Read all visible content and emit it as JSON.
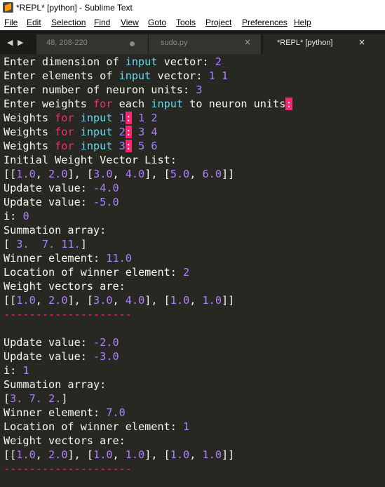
{
  "window": {
    "title": "*REPL* [python] - Sublime Text"
  },
  "menu": [
    "File",
    "Edit",
    "Selection",
    "Find",
    "View",
    "Goto",
    "Tools",
    "Project",
    "Preferences",
    "Help"
  ],
  "tabs": [
    {
      "label": "48, 208-220"
    },
    {
      "label": "sudo.py"
    },
    {
      "label": "*REPL* [python]"
    }
  ],
  "icons": {
    "nav_left": "◀",
    "nav_right": "▶",
    "close": "×"
  },
  "colors": {
    "background": "#272822",
    "keyword": "#f92672",
    "builtin": "#66d9ef",
    "number": "#ae81ff",
    "text": "#f8f8f2"
  },
  "console": [
    [
      [
        "t",
        "Enter dimension of "
      ],
      [
        "b",
        "input"
      ],
      [
        "t",
        " vector: "
      ],
      [
        "n",
        "2"
      ]
    ],
    [
      [
        "t",
        "Enter elements of "
      ],
      [
        "b",
        "input"
      ],
      [
        "t",
        " vector: "
      ],
      [
        "n",
        "1 1"
      ]
    ],
    [
      [
        "t",
        "Enter number of neuron units: "
      ],
      [
        "n",
        "3"
      ]
    ],
    [
      [
        "t",
        "Enter weights "
      ],
      [
        "k",
        "for"
      ],
      [
        "t",
        " each "
      ],
      [
        "b",
        "input"
      ],
      [
        "t",
        " to neuron units"
      ],
      [
        "h",
        ":"
      ]
    ],
    [
      [
        "t",
        "Weights "
      ],
      [
        "k",
        "for"
      ],
      [
        "t",
        " "
      ],
      [
        "b",
        "input"
      ],
      [
        "t",
        " "
      ],
      [
        "n",
        "1"
      ],
      [
        "h",
        ":"
      ],
      [
        "t",
        " "
      ],
      [
        "n",
        "1 2"
      ]
    ],
    [
      [
        "t",
        "Weights "
      ],
      [
        "k",
        "for"
      ],
      [
        "t",
        " "
      ],
      [
        "b",
        "input"
      ],
      [
        "t",
        " "
      ],
      [
        "n",
        "2"
      ],
      [
        "h",
        ":"
      ],
      [
        "t",
        " "
      ],
      [
        "n",
        "3 4"
      ]
    ],
    [
      [
        "t",
        "Weights "
      ],
      [
        "k",
        "for"
      ],
      [
        "t",
        " "
      ],
      [
        "b",
        "input"
      ],
      [
        "t",
        " "
      ],
      [
        "n",
        "3"
      ],
      [
        "h",
        ":"
      ],
      [
        "t",
        " "
      ],
      [
        "n",
        "5 6"
      ]
    ],
    [
      [
        "t",
        "Initial Weight Vector List:"
      ]
    ],
    [
      [
        "t",
        "[["
      ],
      [
        "n",
        "1.0"
      ],
      [
        "t",
        ", "
      ],
      [
        "n",
        "2.0"
      ],
      [
        "t",
        "], ["
      ],
      [
        "n",
        "3.0"
      ],
      [
        "t",
        ", "
      ],
      [
        "n",
        "4.0"
      ],
      [
        "t",
        "], ["
      ],
      [
        "n",
        "5.0"
      ],
      [
        "t",
        ", "
      ],
      [
        "n",
        "6.0"
      ],
      [
        "t",
        "]]"
      ]
    ],
    [
      [
        "t",
        "Update value: "
      ],
      [
        "n",
        "-4.0"
      ]
    ],
    [
      [
        "t",
        "Update value: "
      ],
      [
        "n",
        "-5.0"
      ]
    ],
    [
      [
        "t",
        "i: "
      ],
      [
        "n",
        "0"
      ]
    ],
    [
      [
        "t",
        "Summation array:"
      ]
    ],
    [
      [
        "t",
        "[ "
      ],
      [
        "n",
        "3."
      ],
      [
        "t",
        "  "
      ],
      [
        "n",
        "7."
      ],
      [
        "t",
        " "
      ],
      [
        "n",
        "11."
      ],
      [
        "t",
        "]"
      ]
    ],
    [
      [
        "t",
        "Winner element: "
      ],
      [
        "n",
        "11.0"
      ]
    ],
    [
      [
        "t",
        "Location of winner element: "
      ],
      [
        "n",
        "2"
      ]
    ],
    [
      [
        "t",
        "Weight vectors are:"
      ]
    ],
    [
      [
        "t",
        "[["
      ],
      [
        "n",
        "1.0"
      ],
      [
        "t",
        ", "
      ],
      [
        "n",
        "2.0"
      ],
      [
        "t",
        "], ["
      ],
      [
        "n",
        "3.0"
      ],
      [
        "t",
        ", "
      ],
      [
        "n",
        "4.0"
      ],
      [
        "t",
        "], ["
      ],
      [
        "n",
        "1.0"
      ],
      [
        "t",
        ", "
      ],
      [
        "n",
        "1.0"
      ],
      [
        "t",
        "]]"
      ]
    ],
    [
      [
        "d",
        "--------------------"
      ]
    ],
    [],
    [
      [
        "t",
        "Update value: "
      ],
      [
        "n",
        "-2.0"
      ]
    ],
    [
      [
        "t",
        "Update value: "
      ],
      [
        "n",
        "-3.0"
      ]
    ],
    [
      [
        "t",
        "i: "
      ],
      [
        "n",
        "1"
      ]
    ],
    [
      [
        "t",
        "Summation array:"
      ]
    ],
    [
      [
        "t",
        "["
      ],
      [
        "n",
        "3."
      ],
      [
        "t",
        " "
      ],
      [
        "n",
        "7."
      ],
      [
        "t",
        " "
      ],
      [
        "n",
        "2."
      ],
      [
        "t",
        "]"
      ]
    ],
    [
      [
        "t",
        "Winner element: "
      ],
      [
        "n",
        "7.0"
      ]
    ],
    [
      [
        "t",
        "Location of winner element: "
      ],
      [
        "n",
        "1"
      ]
    ],
    [
      [
        "t",
        "Weight vectors are:"
      ]
    ],
    [
      [
        "t",
        "[["
      ],
      [
        "n",
        "1.0"
      ],
      [
        "t",
        ", "
      ],
      [
        "n",
        "2.0"
      ],
      [
        "t",
        "], ["
      ],
      [
        "n",
        "1.0"
      ],
      [
        "t",
        ", "
      ],
      [
        "n",
        "1.0"
      ],
      [
        "t",
        "], ["
      ],
      [
        "n",
        "1.0"
      ],
      [
        "t",
        ", "
      ],
      [
        "n",
        "1.0"
      ],
      [
        "t",
        "]]"
      ]
    ],
    [
      [
        "d",
        "--------------------"
      ]
    ]
  ]
}
